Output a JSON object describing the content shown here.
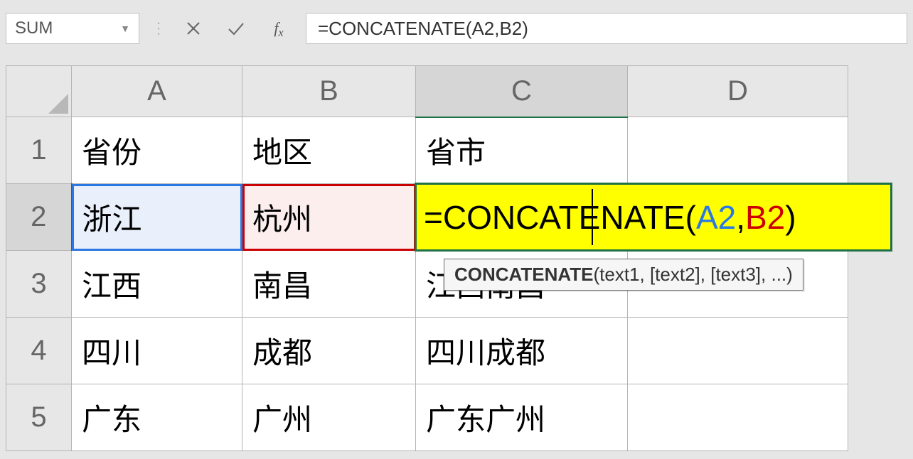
{
  "formula_bar": {
    "name_box": "SUM",
    "fx_label": "f",
    "fx_sub": "x",
    "formula_text": "=CONCATENATE(A2,B2)"
  },
  "columns": [
    "A",
    "B",
    "C",
    "D"
  ],
  "rows": [
    "1",
    "2",
    "3",
    "4",
    "5"
  ],
  "active_cell": "C2",
  "referenced_cells": {
    "A2": "blue",
    "B2": "red"
  },
  "editing_formula": {
    "prefix": "=CONCATENATE(",
    "ref_a": "A2",
    "comma": ",",
    "ref_b": "B2",
    "suffix": ")"
  },
  "tooltip": {
    "fn": "CONCATENATE",
    "args": "(text1, [text2], [text3], ...)"
  },
  "cells": {
    "A1": "省份",
    "B1": "地区",
    "C1": "省市",
    "D1": "",
    "A2": "浙江",
    "B2": "杭州",
    "C2": "",
    "D2": "",
    "A3": "江西",
    "B3": "南昌",
    "C3": "江西南昌",
    "D3": "",
    "A4": "四川",
    "B4": "成都",
    "C4": "四川成都",
    "D4": "",
    "A5": "广东",
    "B5": "广州",
    "C5": "广东广州",
    "D5": ""
  }
}
